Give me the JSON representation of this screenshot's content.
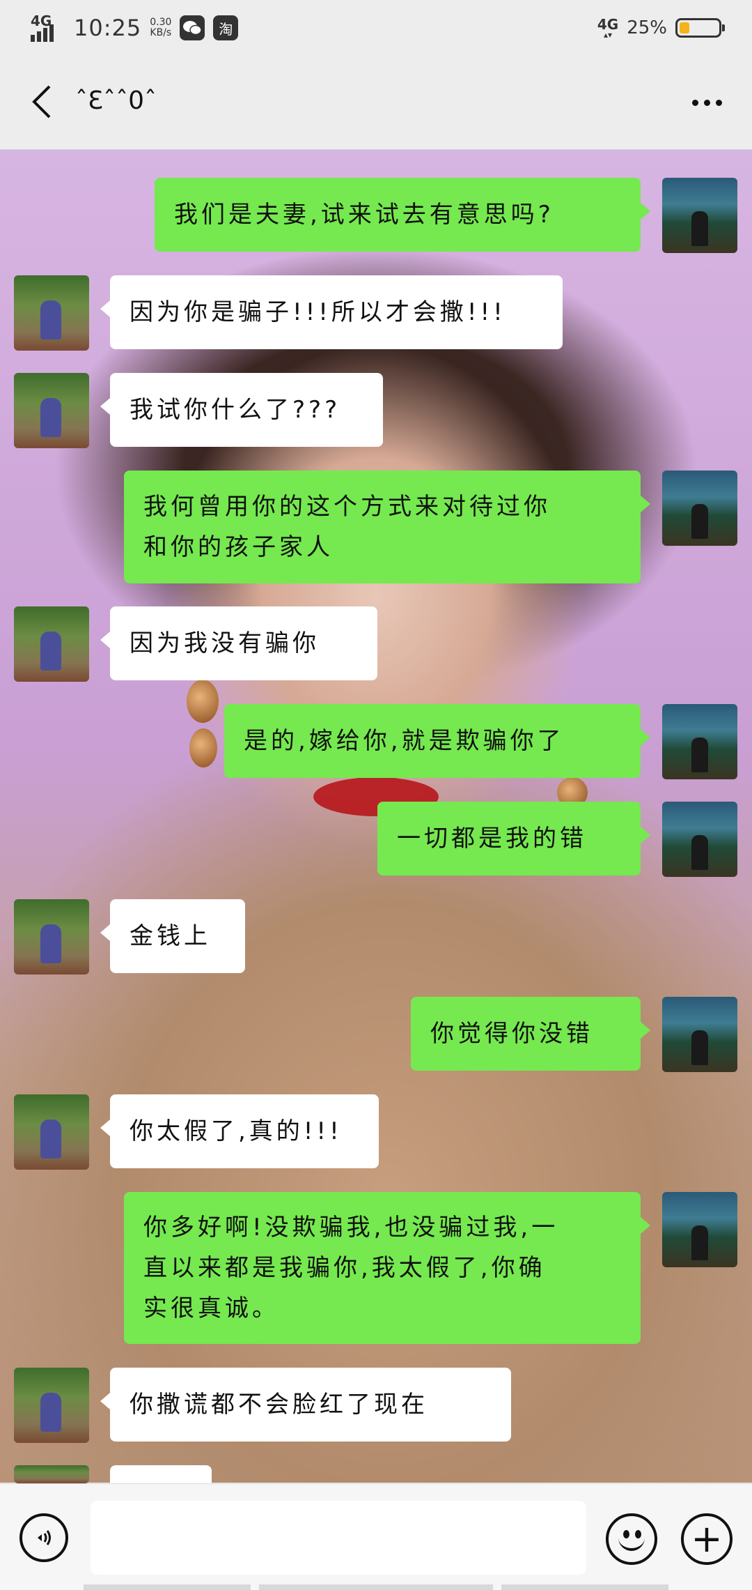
{
  "status_bar": {
    "network": "4G",
    "time": "10:25",
    "speed_value": "0.30",
    "speed_unit": "KB/s",
    "app_icons": [
      "wechat-icon",
      "taobao-icon"
    ],
    "taobao_glyph": "淘",
    "right_network": "4G",
    "battery_percent": "25%",
    "battery_level": 0.25
  },
  "header": {
    "title": "ˆƐˆˆ0ˆ",
    "back_icon": "chevron-left-icon",
    "more_icon": "more-dots-icon"
  },
  "messages": [
    {
      "side": "me",
      "text": "我们是夫妻,试来试去有意思吗?"
    },
    {
      "side": "other",
      "text": "因为你是骗子!!!所以才会撒!!!"
    },
    {
      "side": "other",
      "text": "我试你什么了???"
    },
    {
      "side": "me",
      "lines": [
        "我何曾用你的这个方式来对待过你",
        "和你的孩子家人"
      ]
    },
    {
      "side": "other",
      "text": "因为我没有骗你"
    },
    {
      "side": "me",
      "text": "是的,嫁给你,就是欺骗你了"
    },
    {
      "side": "me",
      "text": "一切都是我的错"
    },
    {
      "side": "other",
      "text": "金钱上"
    },
    {
      "side": "me",
      "text": "你觉得你没错"
    },
    {
      "side": "other",
      "text": "你太假了,真的!!!"
    },
    {
      "side": "me",
      "lines": [
        "你多好啊!没欺骗我,也没骗过我,一",
        "直以来都是我骗你,我太假了,你确",
        "实很真诚。"
      ]
    },
    {
      "side": "other",
      "text": "你撒谎都不会脸红了现在"
    }
  ],
  "input_bar": {
    "voice_icon": "voice-icon",
    "emoji_icon": "emoji-icon",
    "plus_icon": "plus-icon",
    "plus_glyph": "+",
    "text_value": ""
  }
}
